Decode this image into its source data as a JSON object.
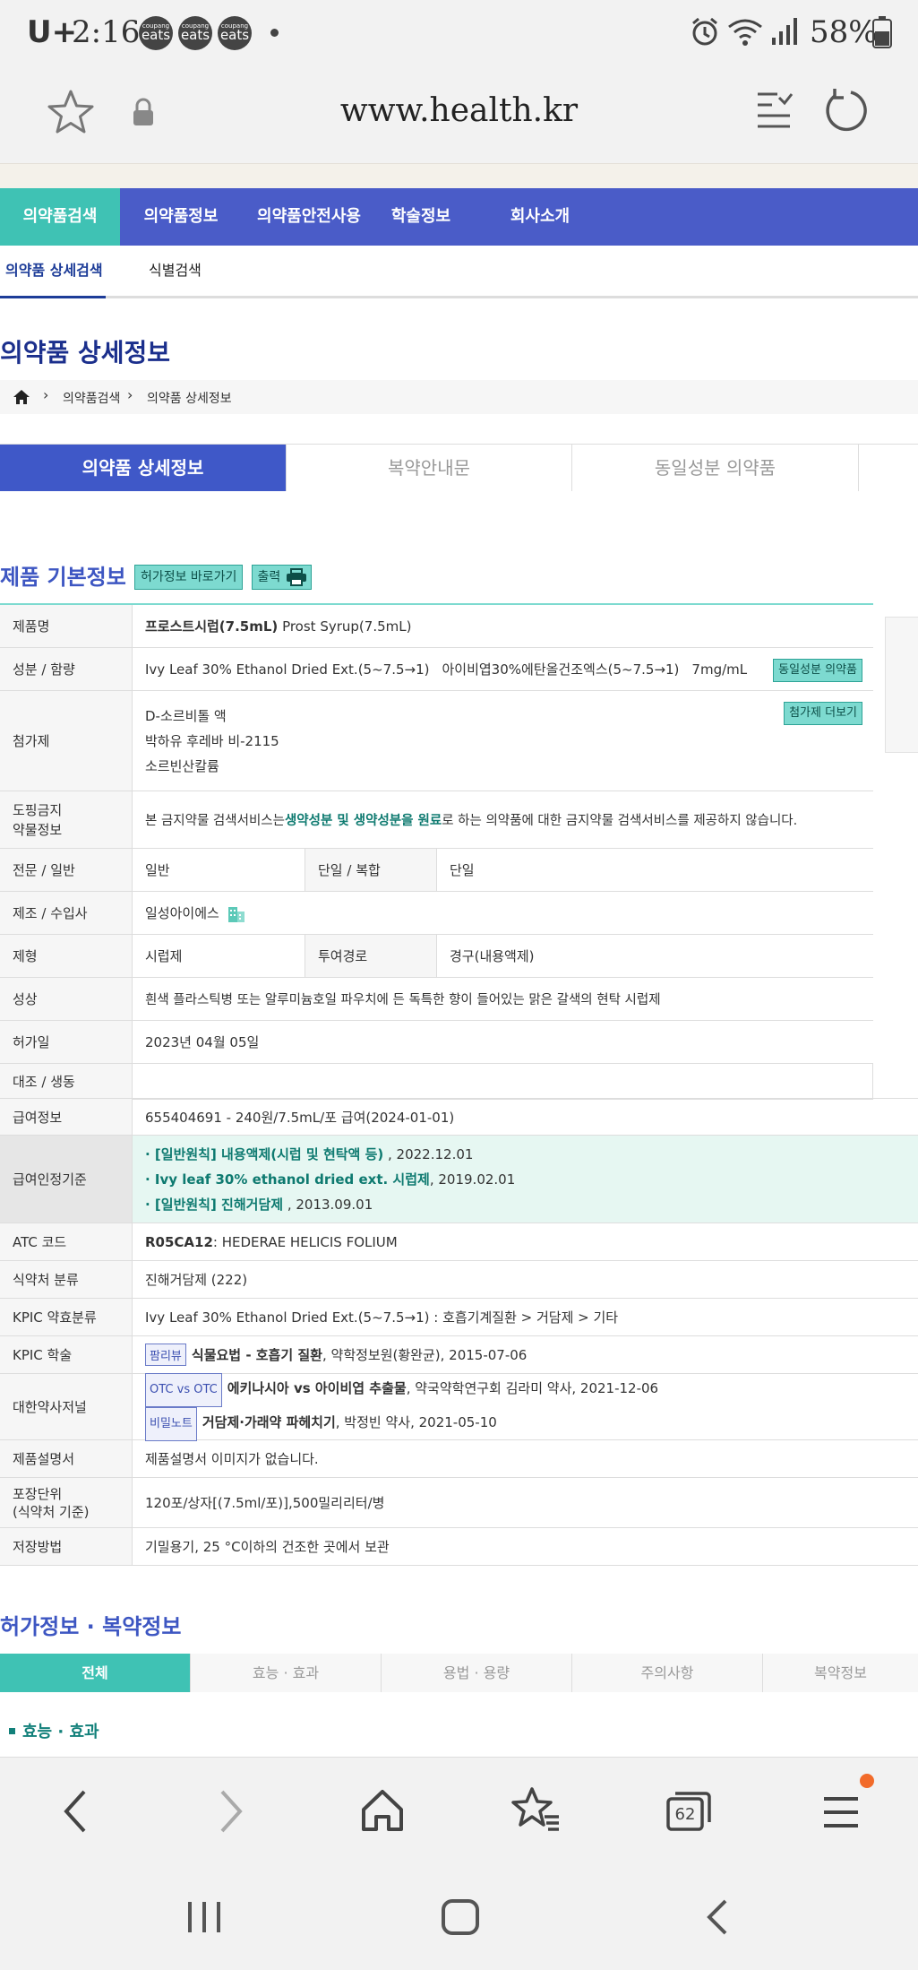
{
  "status_bar": {
    "carrier": "U+",
    "time": "2:16",
    "notifications": [
      "coupang eats",
      "coupang eats",
      "coupang eats"
    ],
    "battery": "58%"
  },
  "browser": {
    "url": "www.health.kr",
    "tabs_count": "62"
  },
  "gnb": {
    "items": [
      "의약품검색",
      "의약품정보",
      "의약품안전사용",
      "학술정보",
      "회사소개"
    ]
  },
  "subnav": {
    "items": [
      "의약품 상세검색",
      "식별검색"
    ]
  },
  "page": {
    "title": "의약품 상세정보",
    "breadcrumb": [
      "의약품검색",
      "의약품 상세정보"
    ]
  },
  "main_tabs": [
    "의약품 상세정보",
    "복약안내문",
    "동일성분 의약품"
  ],
  "basic_info": {
    "title": "제품 기본정보",
    "btn_permit": "허가정보 바로가기",
    "btn_print": "출력",
    "rows": {
      "name_label": "제품명",
      "name_bold": "프로스트시럽(7.5mL)",
      "name_en": "Prost Syrup(7.5mL)",
      "ingredient_label": "성분 / 함량",
      "ingredient_en": "Ivy Leaf 30% Ethanol Dried Ext.(5~7.5→1)",
      "ingredient_ko": "아이비엽30%에탄올건조엑스(5~7.5→1)",
      "ingredient_amount": "7mg/mL",
      "ingredient_btn": "동일성분 의약품",
      "additive_label": "첨가제",
      "additives": [
        "D-소르비톨 액",
        "박하유 후레바 비-2115",
        "소르빈산칼륨"
      ],
      "additive_btn": "첨가제 더보기",
      "doping_label_1": "도핑금지",
      "doping_label_2": "약물정보",
      "doping_pre": "본 금지약물 검색서비스는 ",
      "doping_bold": "생약성분 및 생약성분을 원료",
      "doping_post": "로 하는 의약품에 대한 금지약물 검색서비스를 제공하지 않습니다.",
      "otc_label": "전문 / 일반",
      "otc_value": "일반",
      "single_label": "단일 / 복합",
      "single_value": "단일",
      "maker_label": "제조 / 수입사",
      "maker_value": "일성아이에스",
      "form_label": "제형",
      "form_value": "시럽제",
      "route_label": "투여경로",
      "route_value": "경구(내용액제)",
      "appearance_label": "성상",
      "appearance_value": "흰색 플라스틱병 또는 알루미늄호일 파우치에 든 독특한 향이 들어있는 맑은 갈색의 현탁 시럽제",
      "permit_date_label": "허가일",
      "permit_date_value": "2023년 04월 05일",
      "generic_label": "대조 / 생동",
      "insurance_label": "급여정보",
      "insurance_value": "655404691 - 240원/7.5mL/포 급여(2024-01-01)",
      "criteria_label": "급여인정기준",
      "criteria": [
        {
          "bold": "· [일반원칙] 내용액제(시럽 및 현탁액 등)",
          "date": " , 2022.12.01"
        },
        {
          "bold": "· Ivy leaf 30% ethanol dried ext. 시럽제",
          "date": ", 2019.02.01"
        },
        {
          "bold": "· [일반원칙] 진해거담제",
          "date": " , 2013.09.01"
        }
      ],
      "atc_label": "ATC 코드",
      "atc_code": "R05CA12",
      "atc_desc": " : HEDERAE HELICIS FOLIUM",
      "mfds_label": "식약처 분류",
      "mfds_value": "진해거담제 (222)",
      "kpic_class_label": "KPIC 약효분류",
      "kpic_class_value": "Ivy Leaf 30% Ethanol Dried Ext.(5~7.5→1) : 호흡기계질환 > 거담제 > 기타",
      "kpic_study_label": "KPIC 학술",
      "kpic_study_tag": "팜리뷰",
      "kpic_study_bold": "식물요법 - 호흡기 질환",
      "kpic_study_rest": ", 약학정보원(황완균), 2015-07-06",
      "journal_label": "대한약사저널",
      "journal_1_tag": "OTC vs OTC",
      "journal_1_bold": "에키나시아 vs 아이비엽 추출물",
      "journal_1_rest": ", 약국약학연구회 김라미 약사, 2021-12-06",
      "journal_2_tag": "비밀노트",
      "journal_2_bold": "거담제·가래약 파헤치기",
      "journal_2_rest": ", 박정빈 약사, 2021-05-10",
      "manual_label": "제품설명서",
      "manual_value": "제품설명서 이미지가 없습니다.",
      "package_label_1": "포장단위",
      "package_label_2": "(식약처 기준)",
      "package_value": "120포/상자[(7.5ml/포)],500밀리리터/병",
      "storage_label": "저장방법",
      "storage_value": "기밀용기, 25 °C이하의 건조한 곳에서 보관"
    }
  },
  "permit_section": {
    "title": "허가정보 · 복약정보",
    "tabs": [
      "전체",
      "효능 · 효과",
      "용법 · 용량",
      "주의사항",
      "복약정보"
    ],
    "first_heading": "효능 · 효과"
  },
  "colors": {
    "nav_blue": "#4a5cc8",
    "mint": "#3fc2b4",
    "title_blue": "#1b2f8c",
    "highlight_bg": "#e6f7f2"
  }
}
